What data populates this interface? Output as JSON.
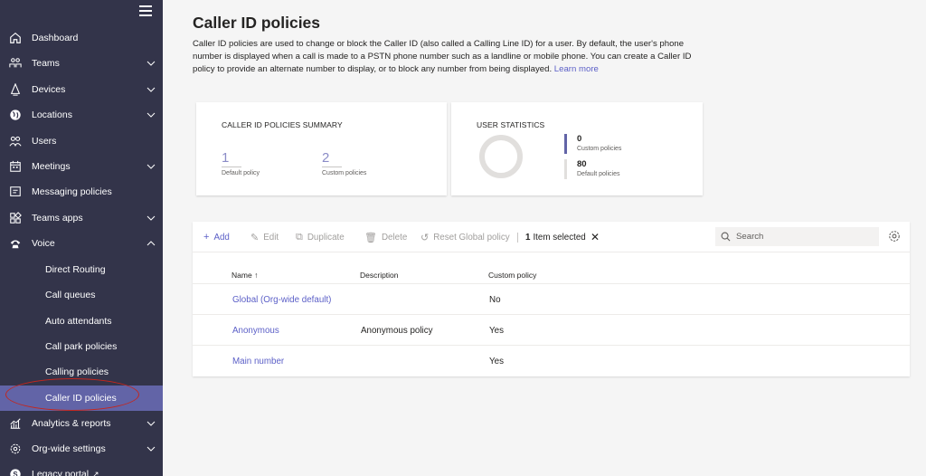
{
  "sidebar": {
    "items": [
      {
        "label": "Dashboard",
        "icon": "home-icon"
      },
      {
        "label": "Teams",
        "icon": "teams-icon",
        "chevron": "down"
      },
      {
        "label": "Devices",
        "icon": "devices-icon",
        "chevron": "down"
      },
      {
        "label": "Locations",
        "icon": "globe-icon",
        "chevron": "down"
      },
      {
        "label": "Users",
        "icon": "users-icon"
      },
      {
        "label": "Meetings",
        "icon": "calendar-icon",
        "chevron": "down"
      },
      {
        "label": "Messaging policies",
        "icon": "message-icon"
      },
      {
        "label": "Teams apps",
        "icon": "apps-icon",
        "chevron": "down"
      },
      {
        "label": "Voice",
        "icon": "phone-icon",
        "chevron": "up"
      }
    ],
    "voice_items": [
      {
        "label": "Direct Routing"
      },
      {
        "label": "Call queues"
      },
      {
        "label": "Auto attendants"
      },
      {
        "label": "Call park policies"
      },
      {
        "label": "Calling policies"
      },
      {
        "label": "Caller ID policies",
        "active": true
      }
    ],
    "bottom_items": [
      {
        "label": "Analytics & reports",
        "icon": "analytics-icon",
        "chevron": "down"
      },
      {
        "label": "Org-wide settings",
        "icon": "settings-icon",
        "chevron": "down"
      },
      {
        "label": "Legacy portal",
        "icon": "legacy-icon"
      }
    ]
  },
  "page": {
    "title": "Caller ID policies",
    "description": "Caller ID policies are used to change or block the Caller ID (also called a Calling Line ID) for a user. By default, the user's phone number is displayed when a call is made to a PSTN phone number such as a landline or mobile phone. You can create a Caller ID policy to provide an alternate number to display, or to block any number from being displayed.",
    "learn_more": "Learn more"
  },
  "summary": {
    "title": "CALLER ID POLICIES SUMMARY",
    "default_count": "1",
    "default_label": "Default policy",
    "custom_count": "2",
    "custom_label": "Custom policies"
  },
  "user_stats": {
    "title": "USER STATISTICS",
    "custom_count": "0",
    "custom_label": "Custom policies",
    "default_count": "80",
    "default_label": "Default policies",
    "custom_color": "#6264a7",
    "default_color": "#e1dfdd"
  },
  "toolbar": {
    "add": "Add",
    "edit": "Edit",
    "duplicate": "Duplicate",
    "delete": "Delete",
    "reset": "Reset Global policy",
    "selected_count": "1",
    "selected_text": "Item selected",
    "search_placeholder": "Search"
  },
  "table": {
    "columns": {
      "name": "Name",
      "description": "Description",
      "custom": "Custom policy"
    },
    "rows": [
      {
        "name": "Global (Org-wide default)",
        "description": "",
        "custom": "No"
      },
      {
        "name": "Anonymous",
        "description": "Anonymous policy",
        "custom": "Yes"
      },
      {
        "name": "Main number",
        "description": "",
        "custom": "Yes"
      }
    ]
  },
  "colors": {
    "sidebar_bg": "#33344a",
    "accent": "#6264a7",
    "link": "#5b5fc7"
  }
}
